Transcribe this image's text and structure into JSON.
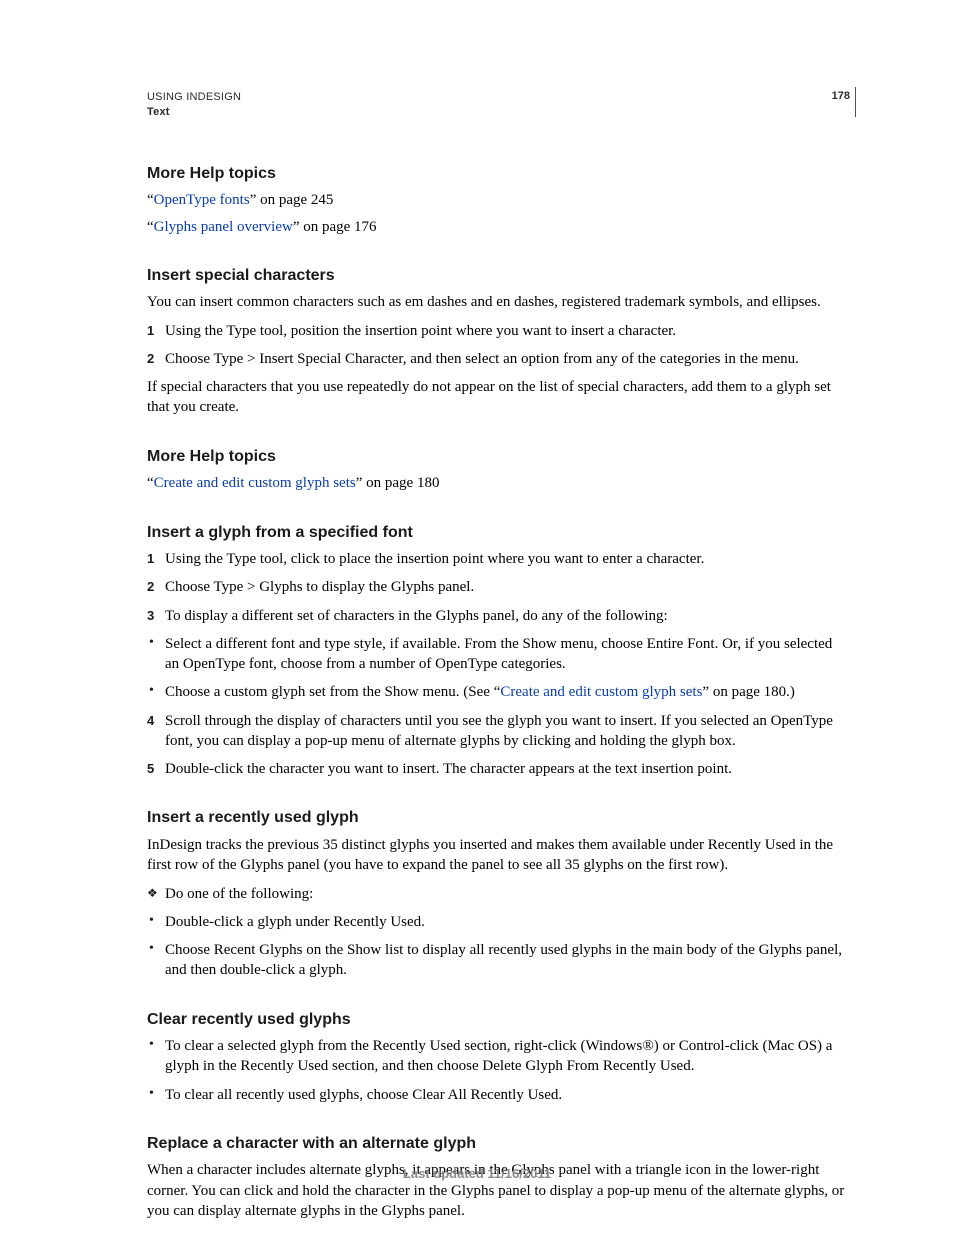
{
  "header": {
    "line1": "USING INDESIGN",
    "line2": "Text",
    "pageNumber": "178"
  },
  "sections": {
    "moreHelp1": {
      "heading": "More Help topics",
      "links": [
        {
          "pre": "“",
          "text": "OpenType fonts",
          "post": "” on page 245"
        },
        {
          "pre": "“",
          "text": "Glyphs panel overview",
          "post": "” on page 176"
        }
      ]
    },
    "insertSpecial": {
      "heading": "Insert special characters",
      "intro": "You can insert common characters such as em dashes and en dashes, registered trademark symbols, and ellipses.",
      "steps": [
        "Using the Type tool, position the insertion point where you want to insert a character.",
        "Choose Type > Insert Special Character, and then select an option from any of the categories in the menu."
      ],
      "outro": "If special characters that you use repeatedly do not appear on the list of special characters, add them to a glyph set that you create."
    },
    "moreHelp2": {
      "heading": "More Help topics",
      "links": [
        {
          "pre": "“",
          "text": "Create and edit custom glyph sets",
          "post": "” on page 180"
        }
      ]
    },
    "insertGlyphFont": {
      "heading": "Insert a glyph from a specified font",
      "steps": [
        {
          "text": "Using the Type tool, click to place the insertion point where you want to enter a character."
        },
        {
          "text": "Choose Type > Glyphs to display the Glyphs panel."
        },
        {
          "text": "To display a different set of characters in the Glyphs panel, do any of the following:",
          "sub": [
            {
              "text": "Select a different font and type style, if available. From the Show menu, choose Entire Font. Or, if you selected an OpenType font, choose from a number of OpenType categories."
            },
            {
              "prefix": "Choose a custom glyph set from the Show menu. (See “",
              "link": "Create and edit custom glyph sets",
              "suffix": "” on page 180.)"
            }
          ]
        },
        {
          "text": "Scroll through the display of characters until you see the glyph you want to insert. If you selected an OpenType font, you can display a pop-up menu of alternate glyphs by clicking and holding the glyph box."
        },
        {
          "text": "Double-click the character you want to insert. The character appears at the text insertion point."
        }
      ]
    },
    "insertRecent": {
      "heading": "Insert a recently used glyph",
      "intro": "InDesign tracks the previous 35 distinct glyphs you inserted and makes them available under Recently Used in the first row of the Glyphs panel (you have to expand the panel to see all 35 glyphs on the first row).",
      "do": "Do one of the following:",
      "bullets": [
        "Double-click a glyph under Recently Used.",
        "Choose Recent Glyphs on the Show list to display all recently used glyphs in the main body of the Glyphs panel, and then double-click a glyph."
      ]
    },
    "clearRecent": {
      "heading": "Clear recently used glyphs",
      "bullets": [
        "To clear a selected glyph from the Recently Used section, right-click (Windows®) or Control-click (Mac OS) a glyph in the Recently Used section, and then choose Delete Glyph From Recently Used.",
        "To clear all recently used glyphs, choose Clear All Recently Used."
      ]
    },
    "replaceAlternate": {
      "heading": "Replace a character with an alternate glyph",
      "para": "When a character includes alternate glyphs, it appears in the Glyphs panel with a triangle icon in the lower-right corner. You can click and hold the character in the Glyphs panel to display a pop-up menu of the alternate glyphs, or you can display alternate glyphs in the Glyphs panel."
    }
  },
  "footer": "Last updated 11/16/2011"
}
